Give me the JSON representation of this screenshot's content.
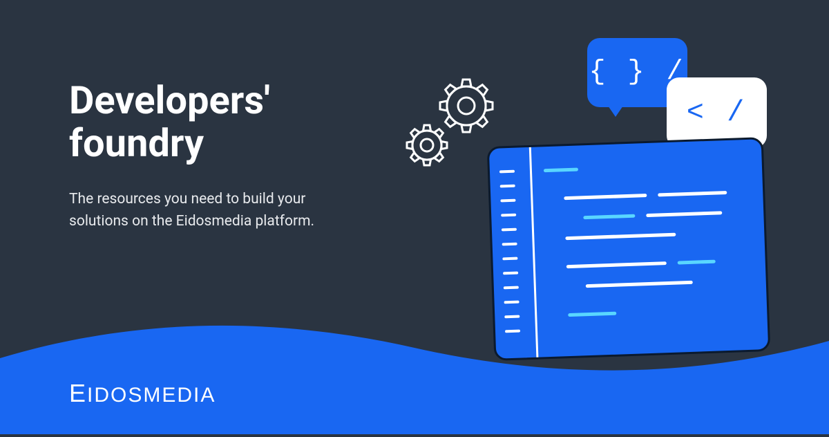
{
  "hero": {
    "title": "Developers' foundry",
    "subtitle": "The resources you need to build your solutions on the Eidosmedia platform."
  },
  "bubbles": {
    "bubble1": "{ } /",
    "bubble2": "< / >"
  },
  "brand": {
    "logo_first": "E",
    "logo_rest": "IDOSMEDIA"
  },
  "colors": {
    "background": "#2a3441",
    "accent": "#1967f2",
    "text": "#ffffff"
  }
}
